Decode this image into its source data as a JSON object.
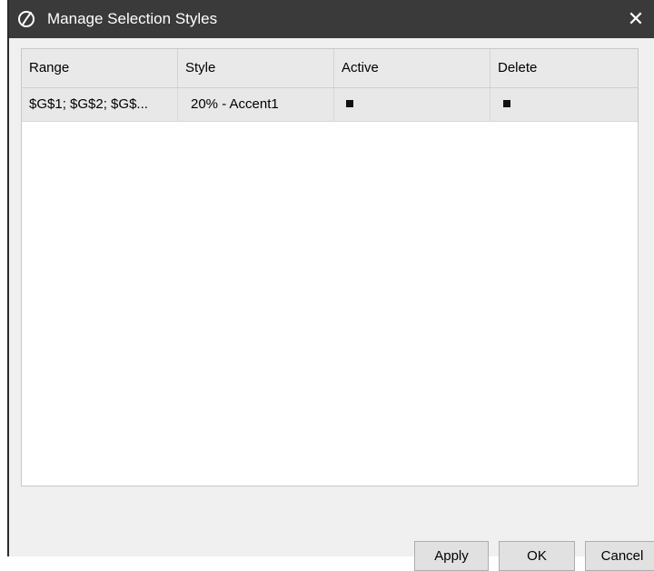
{
  "window": {
    "title": "Manage Selection Styles",
    "close_glyph": "✕"
  },
  "grid": {
    "columns": [
      "Range",
      "Style",
      "Active",
      "Delete"
    ],
    "rows": [
      {
        "range": "$G$1; $G$2; $G$...",
        "style": "20% - Accent1",
        "active": true,
        "delete": true
      }
    ]
  },
  "buttons": {
    "apply": "Apply",
    "ok": "OK",
    "cancel": "Cancel"
  },
  "icons": {
    "app": "app-logo-icon",
    "close": "close-icon",
    "checkbox": "checkbox-checked-icon"
  },
  "colors": {
    "titlebar": "#3a3a3a",
    "dialog_background": "#f0f0f0",
    "header_background": "#e9e9e9",
    "row_background": "#e8e8e8"
  }
}
